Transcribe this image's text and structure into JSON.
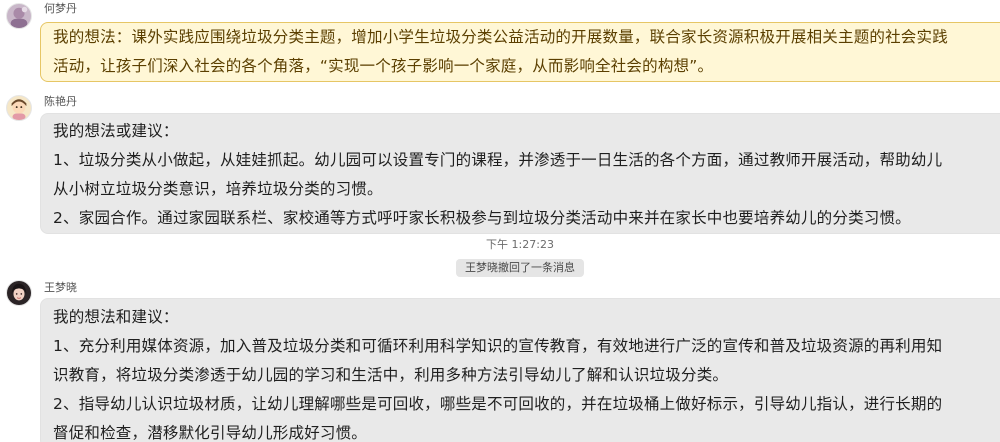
{
  "messages": [
    {
      "sender": "何梦丹",
      "lines": [
        "我的想法：课外实践应围绕垃圾分类主题，增加小学生垃圾分类公益活动的开展数量，联合家长资源积极开展相关主题的社会实践",
        "活动，让孩子们深入社会的各个角落，“实现一个孩子影响一个家庭，从而影响全社会的构想”。"
      ]
    },
    {
      "sender": "陈艳丹",
      "lines": [
        "我的想法或建议：",
        "1、垃圾分类从小做起，从娃娃抓起。幼儿园可以设置专门的课程，并渗透于一日生活的各个方面，通过教师开展活动，帮助幼儿",
        "从小树立垃圾分类意识，培养垃圾分类的习惯。",
        "2、家园合作。通过家园联系栏、家校通等方式呼吁家长积极参与到垃圾分类活动中来并在家长中也要培养幼儿的分类习惯。"
      ]
    },
    {
      "sender": "王梦晓",
      "lines": [
        "我的想法和建议：",
        "1、充分利用媒体资源，加入普及垃圾分类和可循环利用科学知识的宣传教育，有效地进行广泛的宣传和普及垃圾资源的再利用知",
        "识教育，将垃圾分类渗透于幼儿园的学习和生活中，利用多种方法引导幼儿了解和认识垃圾分类。",
        "2、指导幼儿认识垃圾材质，让幼儿理解哪些是可回收，哪些是不可回收的，并在垃圾桶上做好标示，引导幼儿指认，进行长期的",
        "督促和检查，潜移默化引导幼儿形成好习惯。"
      ]
    }
  ],
  "timestamp": "下午 1:27:23",
  "system_notice": "王梦晓撤回了一条消息",
  "colors": {
    "highlight_bubble_bg": "#fff7d6",
    "highlight_bubble_border": "#e6c665",
    "normal_bubble_bg": "#e9e9e9"
  }
}
